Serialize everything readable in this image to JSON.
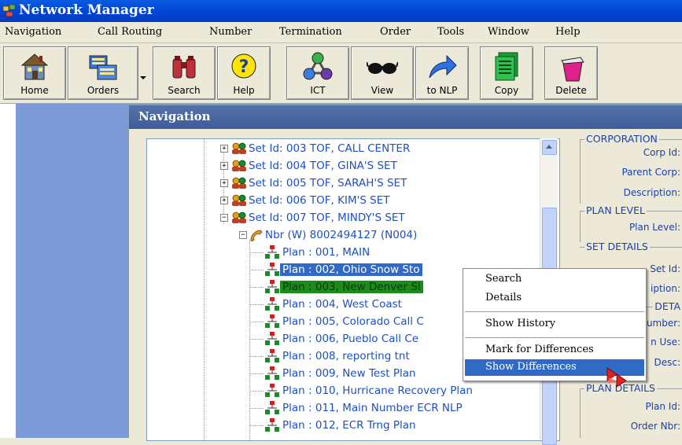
{
  "window": {
    "title": "Network Manager"
  },
  "menu": [
    "Navigation",
    "Call Routing",
    "Number",
    "Termination",
    "Order",
    "Tools",
    "Window",
    "Help"
  ],
  "toolbar": [
    {
      "label": "Home",
      "icon": "house-icon"
    },
    {
      "label": "Orders",
      "icon": "orders-icon"
    },
    {
      "label": "Search",
      "icon": "binoculars-icon"
    },
    {
      "label": "Help",
      "icon": "help-icon"
    },
    {
      "label": "ICT",
      "icon": "molecule-icon"
    },
    {
      "label": "View",
      "icon": "glasses-icon"
    },
    {
      "label": "to NLP",
      "icon": "arrow-icon"
    },
    {
      "label": "Copy",
      "icon": "copy-icon"
    },
    {
      "label": "Delete",
      "icon": "trash-icon"
    }
  ],
  "navigation": {
    "title": "Navigation",
    "sets": [
      "Set Id:  003 TOF, CALL CENTER",
      "Set Id:  004 TOF, GINA'S SET",
      "Set Id:  005 TOF, SARAH'S SET",
      "Set Id:  006 TOF, KIM'S SET",
      "Set Id:  007 TOF, MINDY'S SET"
    ],
    "number": "Nbr (W) 8002494127 (N004)",
    "plans": [
      "Plan : 001, MAIN",
      "Plan : 002, Ohio Snow Sto",
      "Plan : 003, New Denver Sl",
      "Plan : 004, West Coast",
      "Plan : 005, Colorado Call C",
      "Plan : 006, Pueblo Call Ce",
      "Plan : 008, reporting tnt",
      "Plan : 009, New Test Plan",
      "Plan : 010, Hurricane Recovery Plan",
      "Plan : 011, Main Number ECR NLP",
      "Plan : 012, ECR Trng Plan"
    ]
  },
  "context_menu": {
    "items": [
      "Search",
      "Details",
      "Show History",
      "Mark for Differences",
      "Show Differences"
    ],
    "highlighted": "Show Differences"
  },
  "details": {
    "corporation": "CORPORATION",
    "corp_id": "Corp Id:",
    "parent_corp": "Parent Corp:",
    "description": "Description:",
    "plan_level": "PLAN LEVEL",
    "plan_level_field": "Plan Level:",
    "set_details": "SET DETAILS",
    "set_id": "Set Id:",
    "iption": "iption:",
    "deta": "DETA",
    "umber": "umber:",
    "n_use": "n Use:",
    "desc": "Desc:",
    "plan_details": "PLAN DETAILS",
    "plan_id": "Plan Id:",
    "order_nbr": "Order Nbr:"
  },
  "colors": {
    "title_blue": "#0046d5",
    "selection": "#316ac5",
    "selection_green": "#1a8c1a",
    "tree_text": "#1c4fc4"
  }
}
